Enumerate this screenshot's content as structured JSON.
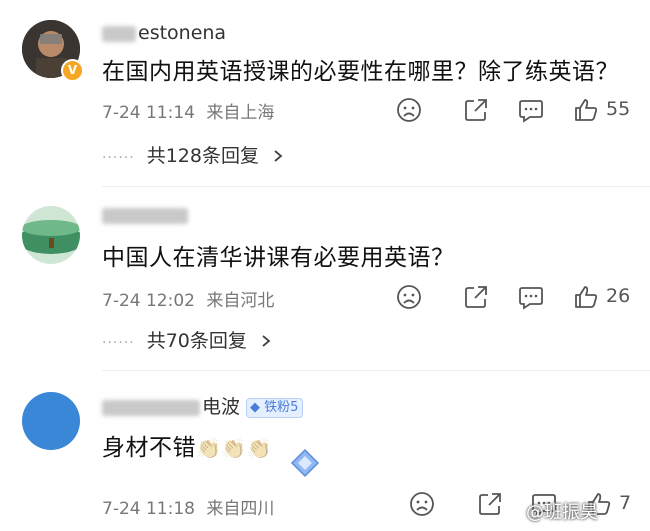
{
  "comments": [
    {
      "username_visible": "estonena",
      "text": "在国内用英语授课的必要性在哪里？除了练英语？",
      "time": "7-24 11:14",
      "location": "来自上海",
      "likes": "55",
      "replies": "共128条回复",
      "avatar_icon": "verified-user-avatar"
    },
    {
      "text": "中国人在清华讲课有必要用英语？",
      "time": "7-24 12:02",
      "location": "来自河北",
      "likes": "26",
      "replies": "共70条回复"
    },
    {
      "username_visible": "电波",
      "badge": "铁粉5",
      "text": "身材不错",
      "emoji": "👏👏👏",
      "time": "7-24 11:18",
      "location": "来自四川",
      "likes": "7"
    }
  ],
  "watermark": "@班振昊",
  "icons": {
    "sad": "sad-face-icon",
    "share": "share-icon",
    "comment": "comment-icon",
    "like": "thumbs-up-icon",
    "chevron": "chevron-right-icon"
  },
  "colors": {
    "text": "#1a1a1a",
    "meta": "#777777",
    "badge": "#4a7fd9",
    "verified": "#f5a623"
  }
}
